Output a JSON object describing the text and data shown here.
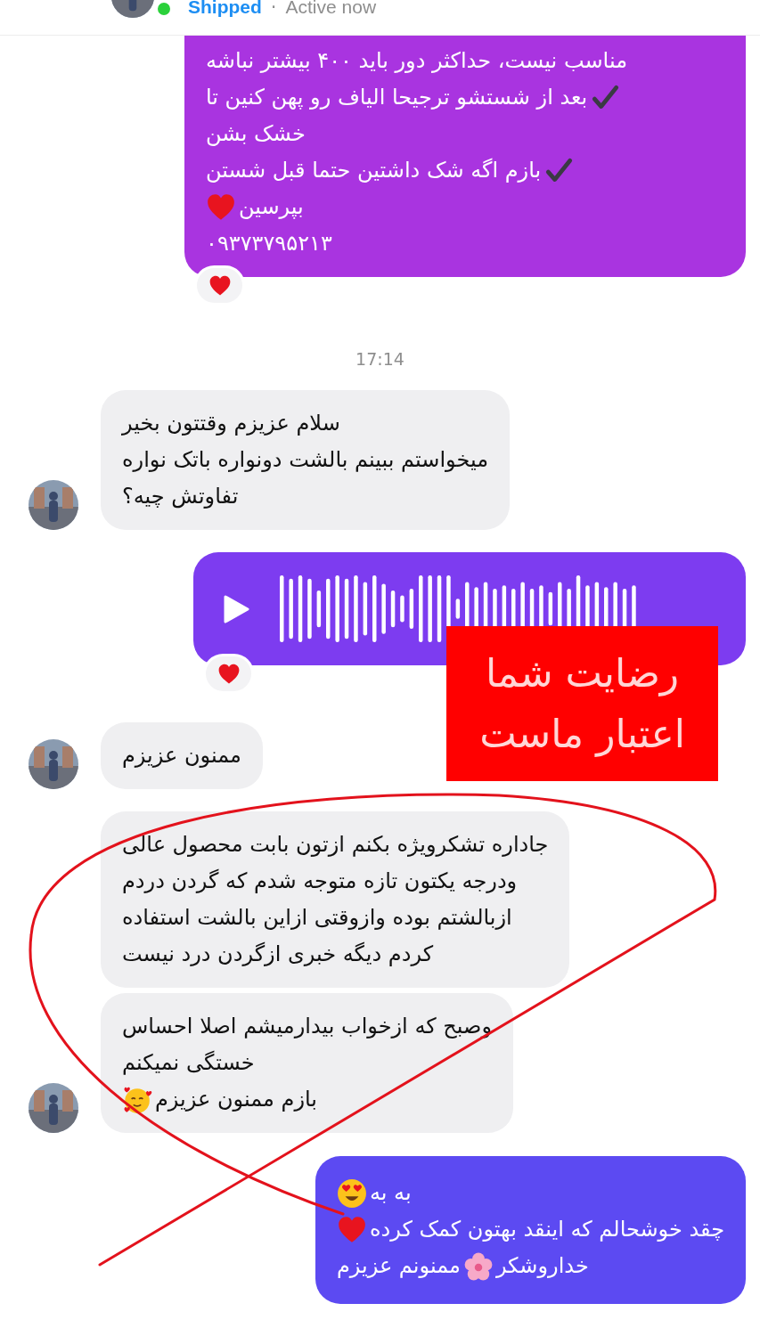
{
  "header": {
    "name": "Shipped",
    "separator": "·",
    "status": "Active now",
    "online": true
  },
  "messages": [
    {
      "kind": "outgoing-text",
      "color": "#a934e0",
      "cut_top": true,
      "reaction": {
        "kind": "heart"
      },
      "lines": [
        [
          {
            "kind": "text",
            "text": "مناسب نیست، حداکثر دور باید ۴۰۰ بیشتر نباشه"
          }
        ],
        [
          {
            "kind": "check"
          },
          {
            "kind": "text",
            "text": "بعد از شستشو ترجیحا الیاف رو پهن کنین تا"
          }
        ],
        [
          {
            "kind": "text",
            "text": "خشک بشن"
          }
        ],
        [
          {
            "kind": "check"
          },
          {
            "kind": "text",
            "text": "بازم اگه شک داشتین حتما قبل شستن"
          }
        ],
        [
          {
            "kind": "text",
            "text": "بپرسین"
          },
          {
            "kind": "heart"
          }
        ],
        [
          {
            "kind": "text",
            "text": "۰۹۳۷۳۷۹۵۲۱۳"
          }
        ]
      ]
    },
    {
      "kind": "time",
      "text": "17:14"
    },
    {
      "kind": "incoming-text",
      "avatar": true,
      "lines": [
        [
          {
            "kind": "text",
            "text": "سلام عزیزم وقتتون بخیر"
          }
        ],
        [
          {
            "kind": "text",
            "text": "میخواستم ببینم بالشت دونواره باتک نواره"
          }
        ],
        [
          {
            "kind": "text",
            "text": "تفاوتش چیه؟"
          }
        ]
      ]
    },
    {
      "kind": "outgoing-voice",
      "color": "#7d3cf0",
      "reaction": {
        "kind": "heart"
      }
    },
    {
      "kind": "incoming-text",
      "avatar": true,
      "lines": [
        [
          {
            "kind": "text",
            "text": "ممنون عزیزم"
          }
        ]
      ]
    },
    {
      "kind": "incoming-text",
      "avatar": false,
      "lines": [
        [
          {
            "kind": "text",
            "text": "جاداره تشکرویژه بکنم ازتون بابت محصول عالی"
          }
        ],
        [
          {
            "kind": "text",
            "text": "ودرجه یکتون تازه متوجه شدم که گردن دردم"
          }
        ],
        [
          {
            "kind": "text",
            "text": "ازبالشتم بوده وازوقتی ازاین بالشت استفاده"
          }
        ],
        [
          {
            "kind": "text",
            "text": "کردم دیگه خبری ازگردن درد نیست"
          }
        ]
      ]
    },
    {
      "kind": "incoming-text",
      "avatar": true,
      "lines": [
        [
          {
            "kind": "text",
            "text": "وصبح که ازخواب بیدارمیشم اصلا احساس"
          }
        ],
        [
          {
            "kind": "text",
            "text": "خستگی نمیکنم"
          }
        ],
        [
          {
            "kind": "text",
            "text": "بازم ممنون عزیزم"
          },
          {
            "kind": "smiling-hearts"
          }
        ]
      ]
    },
    {
      "kind": "outgoing-text",
      "color": "#5c4af2",
      "lines": [
        [
          {
            "kind": "text",
            "text": "به به"
          },
          {
            "kind": "heart-eyes"
          }
        ],
        [
          {
            "kind": "text",
            "text": "چقد خوشحالم که اینقد بهتون کمک کرده"
          },
          {
            "kind": "heart"
          }
        ],
        [
          {
            "kind": "text",
            "text": "خداروشکر"
          },
          {
            "kind": "blossom"
          },
          {
            "kind": "text",
            "text": "ممنونم عزیزم"
          }
        ]
      ]
    }
  ],
  "overlay": {
    "lines": [
      "رضایت شما",
      "اعتبار ماست"
    ]
  }
}
